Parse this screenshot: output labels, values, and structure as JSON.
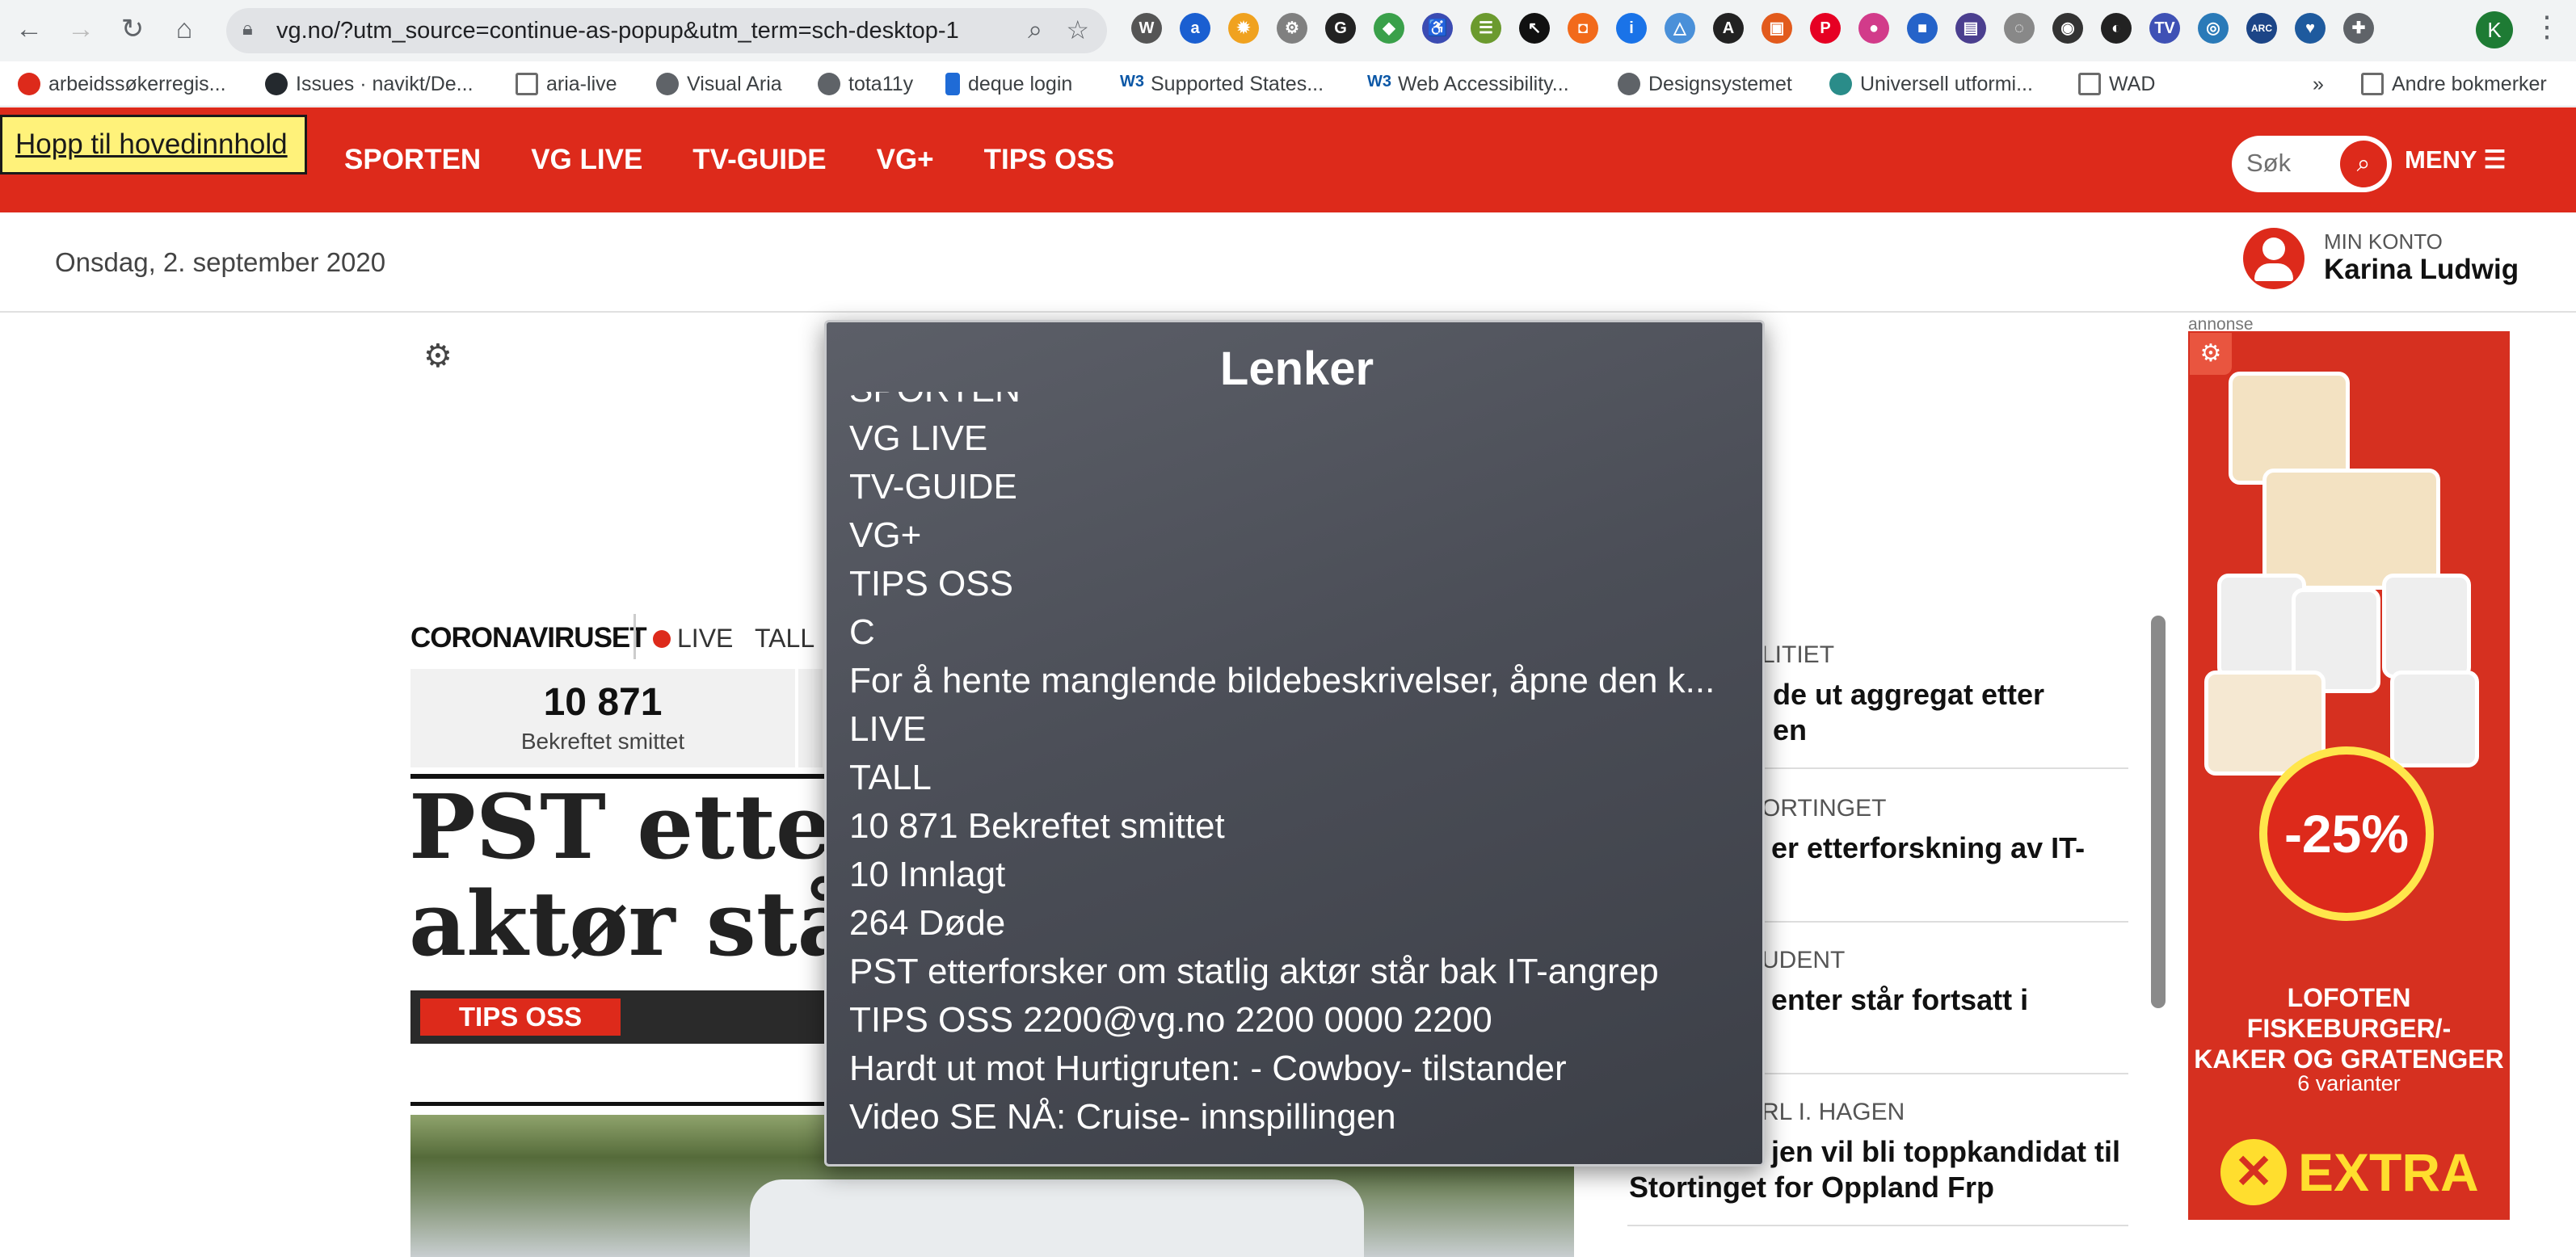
{
  "browser": {
    "url": "vg.no/?utm_source=continue-as-popup&utm_term=sch-desktop-1",
    "profile_initial": "K",
    "extensions": [
      {
        "name": "wordpress-icon",
        "color": "#555555",
        "glyph": "W"
      },
      {
        "name": "axe-icon",
        "color": "#1a5fd1",
        "glyph": "a"
      },
      {
        "name": "settings-icon",
        "color": "#f0a21f",
        "glyph": "✹"
      },
      {
        "name": "gear-ext-icon",
        "color": "#808080",
        "glyph": "⚙"
      },
      {
        "name": "g-icon",
        "color": "#222222",
        "glyph": "G"
      },
      {
        "name": "colors-icon",
        "color": "#3aa04a",
        "glyph": "◆"
      },
      {
        "name": "a11y-icon",
        "color": "#3b4bb2",
        "glyph": "♿"
      },
      {
        "name": "ladder-icon",
        "color": "#6b9a2e",
        "glyph": "☰"
      },
      {
        "name": "cursor-icon",
        "color": "#111111",
        "glyph": "↖"
      },
      {
        "name": "orange-ext-icon",
        "color": "#f26a1b",
        "glyph": "◘"
      },
      {
        "name": "info-icon",
        "color": "#1a73e8",
        "glyph": "i"
      },
      {
        "name": "triangle-icon",
        "color": "#4a90d9",
        "glyph": "△"
      },
      {
        "name": "wa-icon",
        "color": "#222222",
        "glyph": "A"
      },
      {
        "name": "lock-ext-icon",
        "color": "#e25a1c",
        "glyph": "▣"
      },
      {
        "name": "pinterest-icon",
        "color": "#e60023",
        "glyph": "P"
      },
      {
        "name": "colorwheel-icon",
        "color": "#d23b8a",
        "glyph": "●"
      },
      {
        "name": "blue-square-icon",
        "color": "#2563c9",
        "glyph": "■"
      },
      {
        "name": "chart-ext-icon",
        "color": "#4b3f8f",
        "glyph": "▤"
      },
      {
        "name": "ring-icon",
        "color": "#888888",
        "glyph": "◌"
      },
      {
        "name": "camera-icon",
        "color": "#333333",
        "glyph": "◉"
      },
      {
        "name": "contrast-icon",
        "color": "#222222",
        "glyph": "◐"
      },
      {
        "name": "tv-ext-icon",
        "color": "#3f51b5",
        "glyph": "TV"
      },
      {
        "name": "target-icon",
        "color": "#2a7ab8",
        "glyph": "◎"
      },
      {
        "name": "arc-icon",
        "color": "#1c4587",
        "glyph": "ARC"
      },
      {
        "name": "heart-ext-icon",
        "color": "#1e5a9e",
        "glyph": "♥"
      },
      {
        "name": "puzzle-icon",
        "color": "#5f6368",
        "glyph": "✚"
      }
    ],
    "bookmarks": [
      {
        "label": "arbeidssøkerregis...",
        "icon_color": "#dd2a1b"
      },
      {
        "label": "Issues · navikt/De...",
        "icon_color": "#24292e"
      },
      {
        "label": "aria-live",
        "icon_color": "#6b6b6b"
      },
      {
        "label": "Visual Aria",
        "icon_color": "#5f6368"
      },
      {
        "label": "tota11y",
        "icon_color": "#5f6368"
      },
      {
        "label": "deque login",
        "icon_color": "#1f6bd6"
      },
      {
        "label": "Supported States...",
        "icon_color": "#0b57a6"
      },
      {
        "label": "Web Accessibility...",
        "icon_color": "#0b57a6"
      },
      {
        "label": "Designsystemet",
        "icon_color": "#5f6368"
      },
      {
        "label": "Universell utformi...",
        "icon_color": "#2a8c89"
      },
      {
        "label": "WAD",
        "icon_color": "#6b6b6b"
      }
    ],
    "bookmarks_more": "»",
    "other_bookmarks": "Andre bokmerker"
  },
  "page": {
    "skip_link": "Hopp til hovedinnhold",
    "nav": [
      "SPORTEN",
      "VG LIVE",
      "TV-GUIDE",
      "VG+",
      "TIPS OSS"
    ],
    "search_placeholder": "Søk",
    "menu_label": "MENY",
    "date": "Onsdag, 2. september 2020",
    "account_label": "MIN KONTO",
    "account_name": "Karina Ludwig",
    "ad_label": "annonse",
    "corona": {
      "title": "CORONAVIRUSET",
      "live": "LIVE",
      "tall": "TALL",
      "stat_value": "10 871",
      "stat_label": "Bekreftet smittet"
    },
    "headline_line1": "PST etterf",
    "headline_line2": "aktør står",
    "tips_button": "TIPS OSS",
    "right_column": [
      {
        "kicker": "LITIET",
        "title_l1": "de ut aggregat etter",
        "title_l2": "en"
      },
      {
        "kicker": "ORTINGET",
        "title_l1": "er etterforskning av IT-",
        "title_l2": ""
      },
      {
        "kicker": "UDENT",
        "title_l1": "enter står fortsatt i",
        "title_l2": ""
      },
      {
        "kicker": "RL I. HAGEN",
        "title_l1": "jen vil bli toppkandidat til",
        "title_l2": "Stortinget for Oppland Frp"
      }
    ]
  },
  "ad": {
    "discount": "-25%",
    "title_l1": "LOFOTEN",
    "title_l2": "FISKEBURGER/-",
    "title_l3": "KAKER OG GRATENGER",
    "subtitle": "6 varianter",
    "brand": "EXTRA"
  },
  "rotor": {
    "title": "Lenker",
    "items": [
      "SPORTEN",
      "VG LIVE",
      "TV-GUIDE",
      "VG+",
      "TIPS OSS",
      "C",
      "For å hente manglende bildebeskrivelser, åpne den k...",
      "LIVE",
      "TALL",
      "10 871 Bekreftet smittet",
      "10 Innlagt",
      "264 Døde",
      "PST etterforsker om statlig aktør står bak IT-angrep",
      "TIPS OSS 2200@vg.no 2200 0000 2200",
      "Hardt ut mot Hurtigruten: - Cowboy- tilstander",
      "Video SE NÅ: Cruise- innspillingen"
    ]
  }
}
